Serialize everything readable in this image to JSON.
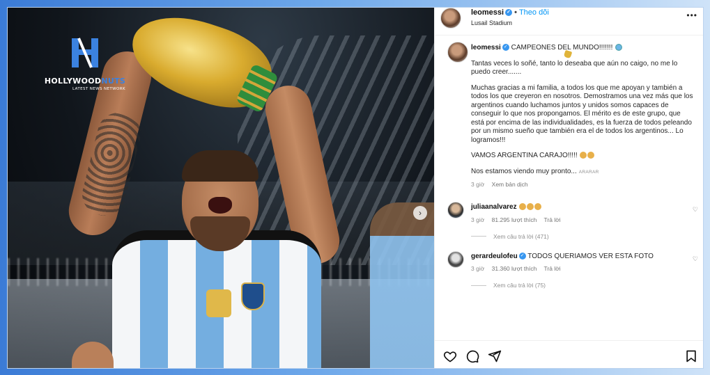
{
  "brand": {
    "name_part1": "HOLLYWOOD",
    "name_part2": "NUTS",
    "tagline": "LATEST NEWS NETWORK"
  },
  "post": {
    "username": "leomessi",
    "follow_label": "Theo dõi",
    "location": "Lusail Stadium",
    "carousel_next_icon": "chevron-right-icon"
  },
  "caption": {
    "username": "leomessi",
    "headline": "CAMPEONES DEL MUNDO!!!!!!!",
    "paragraphs": [
      "Tantas veces lo soñé, tanto lo deseaba que aún no caigo, no me lo puedo creer.......",
      "Muchas gracias a mi familia, a todos los que me apoyan y también a todos los que creyeron en nosotros. Demostramos una vez más que los argentinos cuando luchamos juntos y unidos somos capaces de conseguir lo que nos propongamos. El mérito es de este grupo, que está por encima de las individualidades, es la fuerza de todos peleando por un mismo sueño que también era el de todos los argentinos... Lo logramos!!!",
      "VAMOS ARGENTINA CARAJO!!!!!",
      "Nos estamos viendo muy pronto..."
    ],
    "aa_label": "ARARAR",
    "time": "3 giờ",
    "translate_label": "Xem bản dịch"
  },
  "comments": [
    {
      "username": "juliaanalvarez",
      "text": "",
      "time": "3 giờ",
      "likes": "81.295 lượt thích",
      "reply_label": "Trả lời",
      "view_replies": "Xem câu trả lời (471)"
    },
    {
      "username": "gerardeulofeu",
      "text": "TODOS QUERIAMOS VER ESTA FOTO",
      "time": "3 giờ",
      "likes": "31.360 lượt thích",
      "reply_label": "Trả lời",
      "view_replies": "Xem câu trả lời (75)"
    }
  ],
  "actions": [
    "heart-icon",
    "comment-icon",
    "share-icon",
    "bookmark-icon"
  ],
  "colors": {
    "accent": "#0095f6",
    "verified": "#3897f0",
    "frame_blue": "#3b7bd6"
  }
}
